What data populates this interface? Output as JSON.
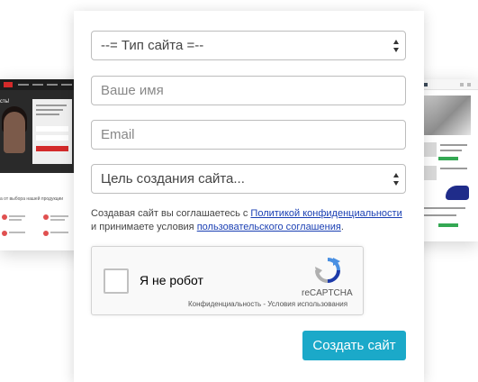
{
  "background": {
    "left_site": {
      "hero_text": "сть!",
      "caption": "а от выбора нашей продукции"
    }
  },
  "form": {
    "site_type_select": "--= Тип сайта =--",
    "name_input_placeholder": "Ваше имя",
    "email_input_placeholder": "Email",
    "purpose_select": "Цель создания сайта...",
    "consent": {
      "text_before": "Создавая сайт вы соглашаетесь с ",
      "privacy_link": "Политикой конфиденциальности",
      "text_middle": " и принимаете условия ",
      "terms_link": "пользовательского соглашения",
      "text_after": "."
    },
    "recaptcha": {
      "label": "Я не робот",
      "brand": "reCAPTCHA",
      "links": "Конфиденциальность - Условия использования"
    },
    "submit_label": "Создать сайт"
  },
  "colors": {
    "submit_button": "#1ba9c9",
    "link": "#1a3fb3"
  }
}
